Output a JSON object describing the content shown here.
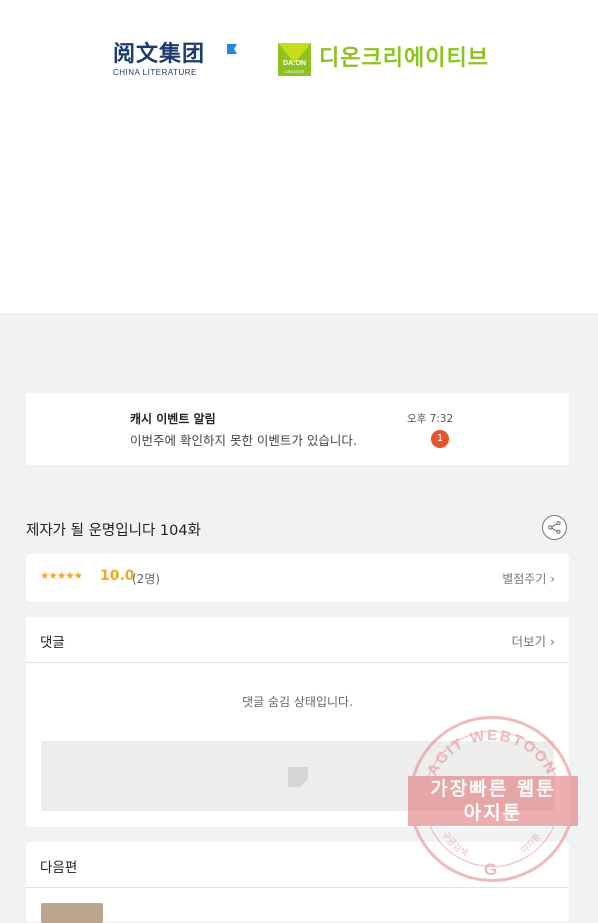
{
  "banner": {
    "china_literature": {
      "cn": "阅文集团",
      "en": "CHINA LITERATURE"
    },
    "daon": {
      "box_text": "DA:ON",
      "box_sub": "CREATIVE",
      "name": "디온크리에이티브"
    }
  },
  "notification": {
    "title": "캐시 이벤트 알림",
    "message": "이번주에 확인하지 못한 이벤트가 있습니다.",
    "time": "오후 7:32",
    "badge": "1"
  },
  "episode": {
    "title": "제자가 될 운명입니다 104화",
    "share_icon": "share-icon"
  },
  "rating": {
    "stars": "★★★★★",
    "score": "10.0",
    "count": "(2명)",
    "rate_button": "별점주기 ›",
    "star_color": "#f5a623"
  },
  "comments": {
    "header": "댓글",
    "more": "더보기 ›",
    "hidden_message": "댓글 숨김 상태입니다."
  },
  "next_episode": {
    "header": "다음편"
  },
  "watermark": {
    "arc_text": "AGIT WEBTOON",
    "line1": "가장빠른 웹툰",
    "line2": "아지툰",
    "bottom_left": "구글검색",
    "bottom_right": "아지툰",
    "g_logo": "G"
  },
  "colors": {
    "badge": "#e5532f",
    "accent_green": "#8dc21f",
    "brand_blue": "#1b3b6b"
  }
}
